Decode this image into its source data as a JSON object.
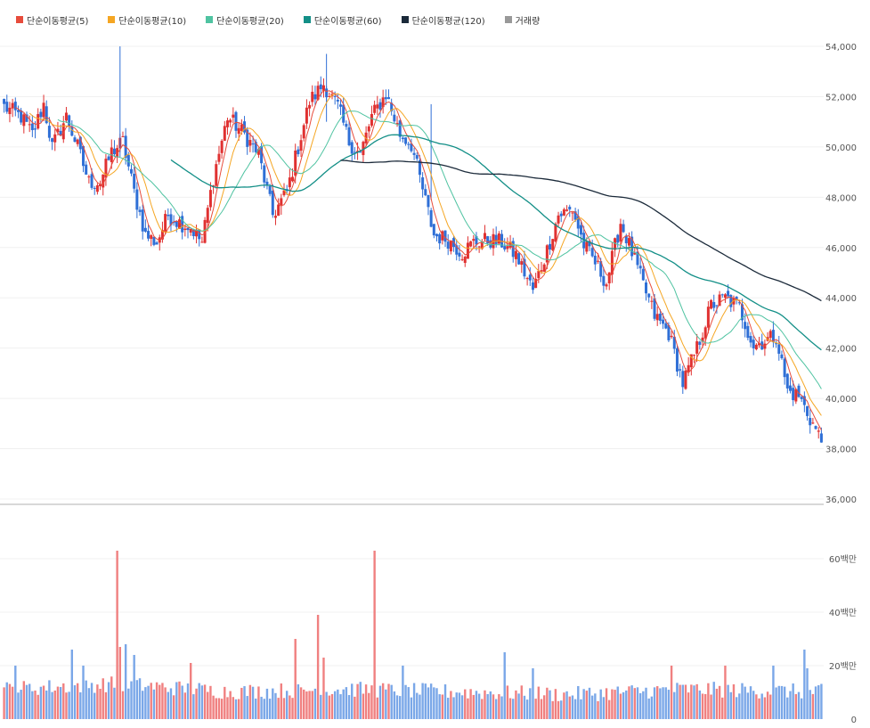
{
  "legend": [
    {
      "label": "단순이동평균(5)",
      "color": "#e74c3c"
    },
    {
      "label": "단순이동평균(10)",
      "color": "#f5a623"
    },
    {
      "label": "단순이동평균(20)",
      "color": "#4fc3a1"
    },
    {
      "label": "단순이동평균(60)",
      "color": "#138f87"
    },
    {
      "label": "단순이동평균(120)",
      "color": "#1b2a3a"
    },
    {
      "label": "거래량",
      "color": "#999999"
    }
  ],
  "chart_data": [
    {
      "type": "candlestick",
      "name": "price",
      "ylim": [
        36000,
        54000
      ],
      "yticks": [
        "54,000",
        "52,000",
        "50,000",
        "48,000",
        "46,000",
        "44,000",
        "42,000",
        "40,000",
        "38,000",
        "36,000"
      ],
      "ytick_values": [
        54000,
        52000,
        50000,
        48000,
        46000,
        44000,
        42000,
        40000,
        38000,
        36000
      ],
      "up_color": "#e03131",
      "down_color": "#2f6fd6",
      "anchors": [
        [
          0,
          51600
        ],
        [
          6,
          51200
        ],
        [
          10,
          50500
        ],
        [
          14,
          51700
        ],
        [
          17,
          50000
        ],
        [
          22,
          51200
        ],
        [
          26,
          50000
        ],
        [
          30,
          48600
        ],
        [
          34,
          48600
        ],
        [
          38,
          49800
        ],
        [
          42,
          50200
        ],
        [
          46,
          48200
        ],
        [
          50,
          46500
        ],
        [
          54,
          46200
        ],
        [
          58,
          47300
        ],
        [
          62,
          47000
        ],
        [
          66,
          46800
        ],
        [
          70,
          46200
        ],
        [
          74,
          48800
        ],
        [
          79,
          51200
        ],
        [
          85,
          50500
        ],
        [
          90,
          49700
        ],
        [
          95,
          47300
        ],
        [
          100,
          48200
        ],
        [
          104,
          50000
        ],
        [
          108,
          51800
        ],
        [
          113,
          52500
        ],
        [
          118,
          51600
        ],
        [
          122,
          50200
        ],
        [
          126,
          49700
        ],
        [
          130,
          51200
        ],
        [
          135,
          52100
        ],
        [
          140,
          50500
        ],
        [
          144,
          50100
        ],
        [
          148,
          48300
        ],
        [
          152,
          46500
        ],
        [
          157,
          46300
        ],
        [
          162,
          45800
        ],
        [
          166,
          46200
        ],
        [
          171,
          46300
        ],
        [
          176,
          46200
        ],
        [
          181,
          45700
        ],
        [
          187,
          44300
        ],
        [
          192,
          45900
        ],
        [
          196,
          47300
        ],
        [
          201,
          47500
        ],
        [
          205,
          46100
        ],
        [
          209,
          45400
        ],
        [
          213,
          44600
        ],
        [
          218,
          47000
        ],
        [
          222,
          45800
        ],
        [
          226,
          44500
        ],
        [
          230,
          43300
        ],
        [
          235,
          42600
        ],
        [
          240,
          40600
        ],
        [
          245,
          42000
        ],
        [
          250,
          43700
        ],
        [
          255,
          44000
        ],
        [
          260,
          43600
        ],
        [
          265,
          42100
        ],
        [
          269,
          42300
        ],
        [
          273,
          42500
        ],
        [
          277,
          40300
        ],
        [
          281,
          40100
        ],
        [
          285,
          39200
        ],
        [
          289,
          38300
        ]
      ],
      "ma": [
        {
          "name": "단순이동평균(5)",
          "window": 5
        },
        {
          "name": "단순이동평균(10)",
          "window": 10
        },
        {
          "name": "단순이동평균(20)",
          "window": 20
        },
        {
          "name": "단순이동평균(60)",
          "window": 60
        },
        {
          "name": "단순이동평균(120)",
          "window": 120
        }
      ]
    },
    {
      "type": "bar",
      "name": "거래량",
      "ylim": [
        0,
        65
      ],
      "yticks": [
        "60백만",
        "40백만",
        "20백만",
        "0"
      ],
      "ytick_values": [
        60,
        40,
        20,
        0
      ],
      "unit": "백만",
      "up_color": "#f08080",
      "down_color": "#7aa7e8",
      "base_levels": [
        [
          0,
          10
        ],
        [
          40,
          12
        ],
        [
          80,
          9
        ],
        [
          120,
          10
        ],
        [
          160,
          9
        ],
        [
          200,
          8
        ],
        [
          240,
          10
        ],
        [
          289,
          9
        ]
      ],
      "spikes": [
        [
          4,
          20
        ],
        [
          24,
          26
        ],
        [
          28,
          20
        ],
        [
          40,
          63
        ],
        [
          41,
          27
        ],
        [
          43,
          28
        ],
        [
          46,
          24
        ],
        [
          66,
          21
        ],
        [
          103,
          30
        ],
        [
          111,
          39
        ],
        [
          113,
          23
        ],
        [
          131,
          63
        ],
        [
          141,
          20
        ],
        [
          177,
          25
        ],
        [
          187,
          19
        ],
        [
          236,
          20
        ],
        [
          255,
          20
        ],
        [
          272,
          20
        ],
        [
          283,
          26
        ],
        [
          284,
          19
        ]
      ]
    }
  ]
}
